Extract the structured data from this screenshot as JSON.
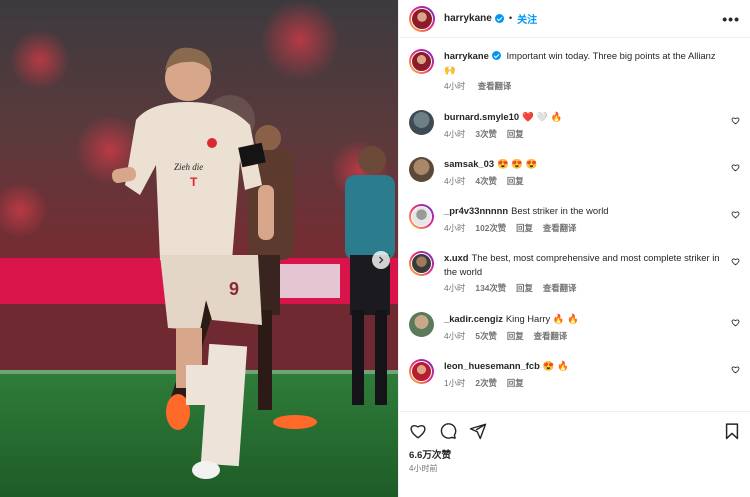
{
  "post": {
    "username": "harrykane",
    "follow_label": "关注",
    "more_label": "•••",
    "caption_username": "harrykane",
    "caption_text": "Important win today. Three big points at the Allianz 🙌",
    "caption_time": "4小时",
    "caption_translate": "查看翻译",
    "likes": "6.6万次赞",
    "time_ago": "4小时前"
  },
  "comments": [
    {
      "username": "burnard.smyle10",
      "text": "❤️ 🤍 🔥",
      "time": "4小时",
      "likes": "3次赞",
      "reply": "回复",
      "translate": ""
    },
    {
      "username": "samsak_03",
      "text": "😍 😍 😍",
      "time": "4小时",
      "likes": "4次赞",
      "reply": "回复",
      "translate": ""
    },
    {
      "username": "_pr4v33nnnnn",
      "text": "Best striker in the world",
      "time": "4小时",
      "likes": "102次赞",
      "reply": "回复",
      "translate": "查看翻译"
    },
    {
      "username": "x.uxd",
      "text": "The best, most comprehensive and most complete striker in the world",
      "time": "4小时",
      "likes": "134次赞",
      "reply": "回复",
      "translate": "查看翻译"
    },
    {
      "username": "_kadir.cengiz",
      "text": "King Harry 🔥 🔥",
      "time": "4小时",
      "likes": "5次赞",
      "reply": "回复",
      "translate": "查看翻译"
    },
    {
      "username": "leon_huesemann_fcb",
      "text": "😍 🔥",
      "time": "1小时",
      "likes": "2次赞",
      "reply": "回复",
      "translate": ""
    }
  ],
  "colors": {
    "link": "#0095f6",
    "verified": "#0095f6",
    "text": "#262626",
    "muted": "#737373"
  },
  "icons": [
    "heart-icon",
    "comment-icon",
    "share-icon",
    "bookmark-icon",
    "more-icon",
    "verified-icon",
    "chevron-right-icon"
  ]
}
